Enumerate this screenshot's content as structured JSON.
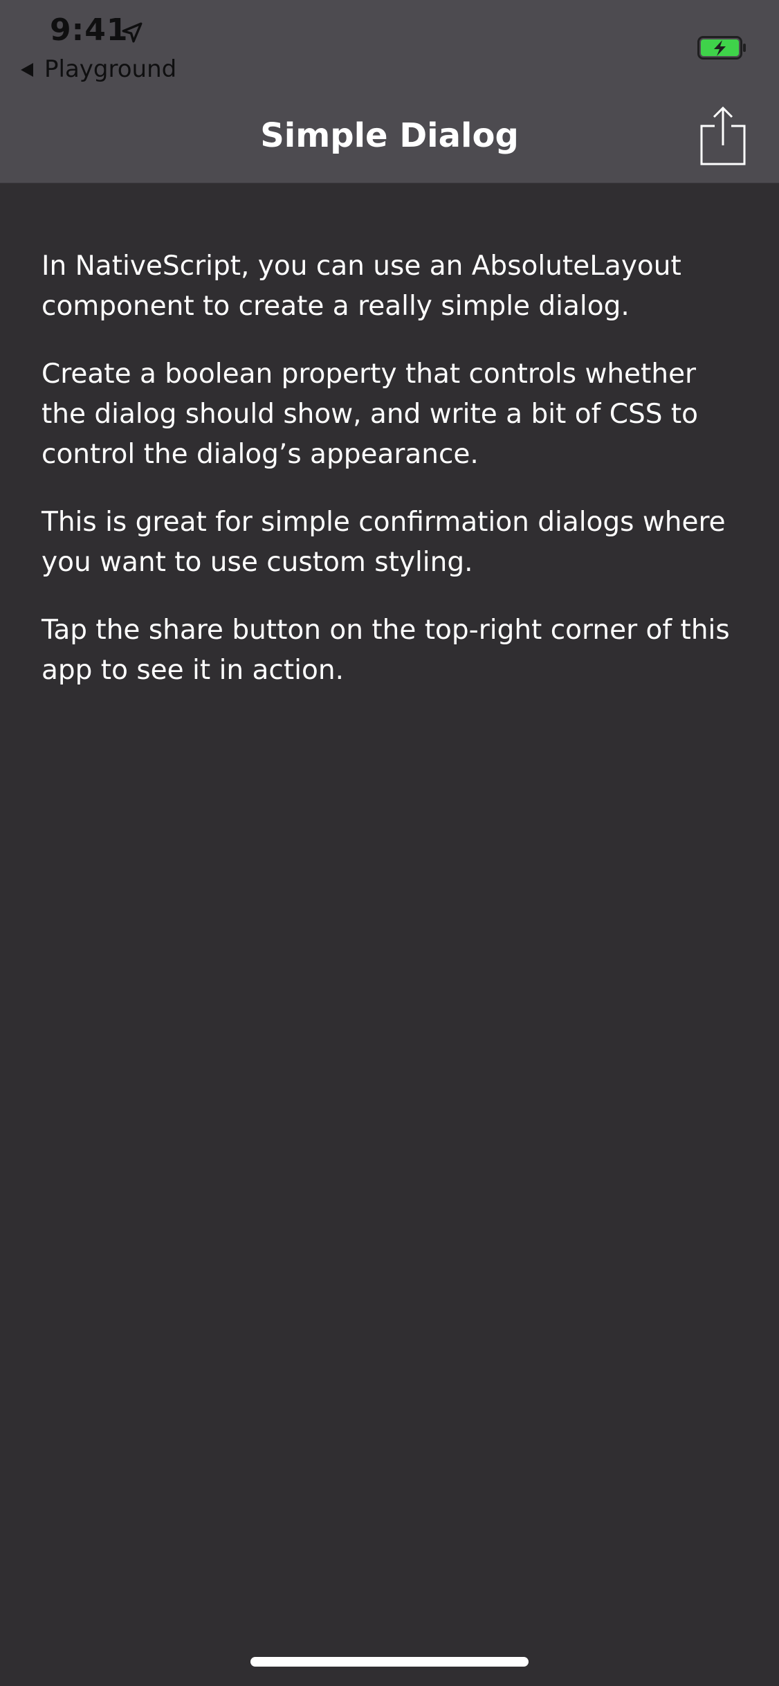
{
  "status_bar": {
    "time": "9:41",
    "location_icon": "location-arrow-icon",
    "battery_icon": "battery-charging-icon"
  },
  "nav": {
    "back_label": "Playground",
    "title": "Simple Dialog",
    "share_icon": "share-icon"
  },
  "content": {
    "paragraphs": [
      "In NativeScript, you can use an AbsoluteLayout component to create a really simple dialog.",
      "Create a boolean property that controls whether the dialog should show, and write a bit of CSS to control the dialog’s appearance.",
      "This is great for simple confirmation dialogs where you want to use custom styling.",
      "Tap the share button on the top-right corner of this app to see it in action."
    ]
  },
  "colors": {
    "background": "#302e31",
    "top_bar": "#4d4b50",
    "battery_green": "#3fd34a",
    "text": "#ffffff"
  }
}
